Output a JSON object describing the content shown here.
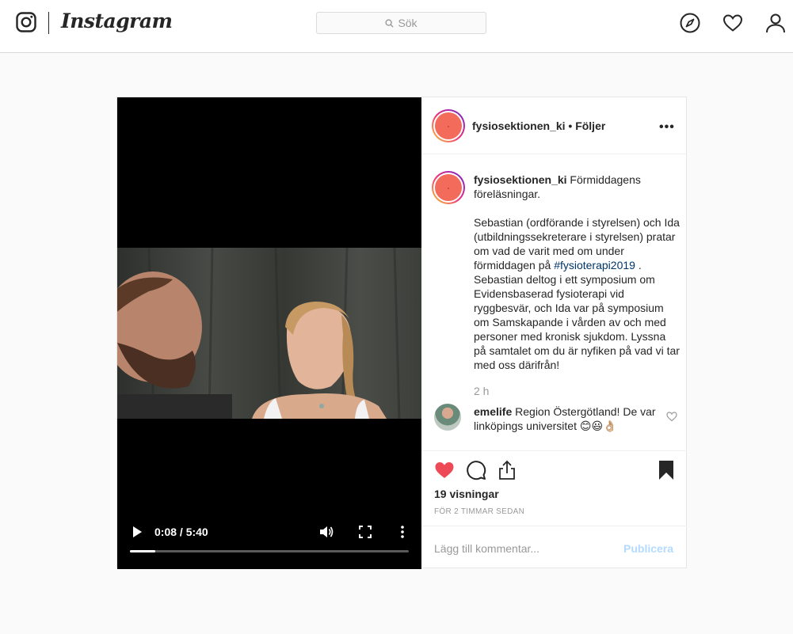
{
  "nav": {
    "wordmark": "Instagram",
    "search_placeholder": "Sök",
    "icons": [
      "instagram-logo-icon",
      "compass-icon",
      "heart-icon",
      "profile-icon"
    ]
  },
  "video": {
    "time": "0:08 / 5:40",
    "progress": 0.09
  },
  "post": {
    "username": "fysiosektionen_ki",
    "separator": "•",
    "follow": "Följer",
    "more": "•••",
    "caption_user": "fysiosektionen_ki",
    "caption_part1": " Förmiddagens föreläsningar.\n\nSebastian (ordförande i styrelsen) och Ida (utbildningssekreterare i styrelsen) pratar om vad de varit med om under förmiddagen på ",
    "caption_tag": "#fysioterapi2019",
    "caption_part2": " . Sebastian deltog i ett symposium om Evidensbaserad fysioterapi vid ryggbesvär, och Ida var på symposium om Samskapande i vården av och med personer med kronisk sjukdom. Lyssna på samtalet om du är nyfiken på vad vi tar med oss därifrån!",
    "time_ago": "2 h",
    "comment_user": "emelife",
    "comment_text": " Region Östergötland! De var linköpings universitet 😊😃👌🏼",
    "views": "19 visningar",
    "posted": "FÖR 2 TIMMAR SEDAN",
    "add_comment_placeholder": "Lägg till kommentar...",
    "publish": "Publicera"
  },
  "colors": {
    "like_red": "#ed4956",
    "hashtag": "#003569",
    "publish_disabled": "#b3dbff",
    "avatar_core": "#f26b5b"
  }
}
